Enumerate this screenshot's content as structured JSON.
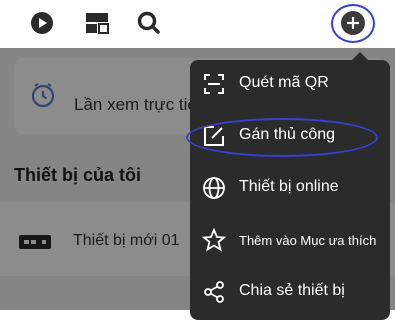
{
  "topbar": {
    "icons": [
      "play-circle-icon",
      "layout-grid-icon",
      "search-icon",
      "add-icon"
    ]
  },
  "card": {
    "label": "Lần xem trực tiếp gần đây",
    "icon": "clock-icon"
  },
  "section": {
    "title": "Thiết bị của tôi"
  },
  "device": {
    "name": "Thiết bị mới 01",
    "icon": "camera-device-icon"
  },
  "menu": {
    "items": [
      {
        "label": "Quét mã QR",
        "icon": "scan-qr-icon"
      },
      {
        "label": "Gán thủ công",
        "icon": "edit-icon"
      },
      {
        "label": "Thiết bị online",
        "icon": "globe-icon"
      },
      {
        "label": "Thêm vào Mục ưa thích",
        "icon": "star-icon"
      },
      {
        "label": "Chia sẻ thiết bị",
        "icon": "share-icon"
      }
    ]
  },
  "colors": {
    "menu_bg": "#2b2b2b",
    "highlight": "#3a3fd1",
    "accent_icon": "#5a7fd6"
  }
}
